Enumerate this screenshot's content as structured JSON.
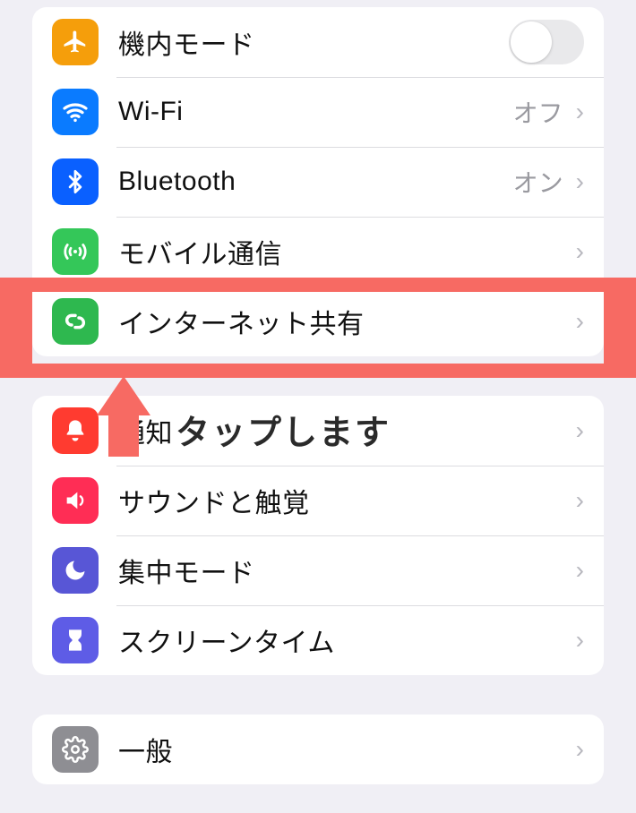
{
  "group1": {
    "airplane": {
      "label": "機内モード"
    },
    "wifi": {
      "label": "Wi-Fi",
      "value": "オフ"
    },
    "bluetooth": {
      "label": "Bluetooth",
      "value": "オン"
    },
    "cellular": {
      "label": "モバイル通信"
    },
    "hotspot": {
      "label": "インターネット共有"
    }
  },
  "group2": {
    "notifications": {
      "label": "通知"
    },
    "sounds": {
      "label": "サウンドと触覚"
    },
    "focus": {
      "label": "集中モード"
    },
    "screentime": {
      "label": "スクリーンタイム"
    }
  },
  "group3": {
    "general": {
      "label": "一般"
    }
  },
  "annotation": {
    "text": "タップします"
  }
}
